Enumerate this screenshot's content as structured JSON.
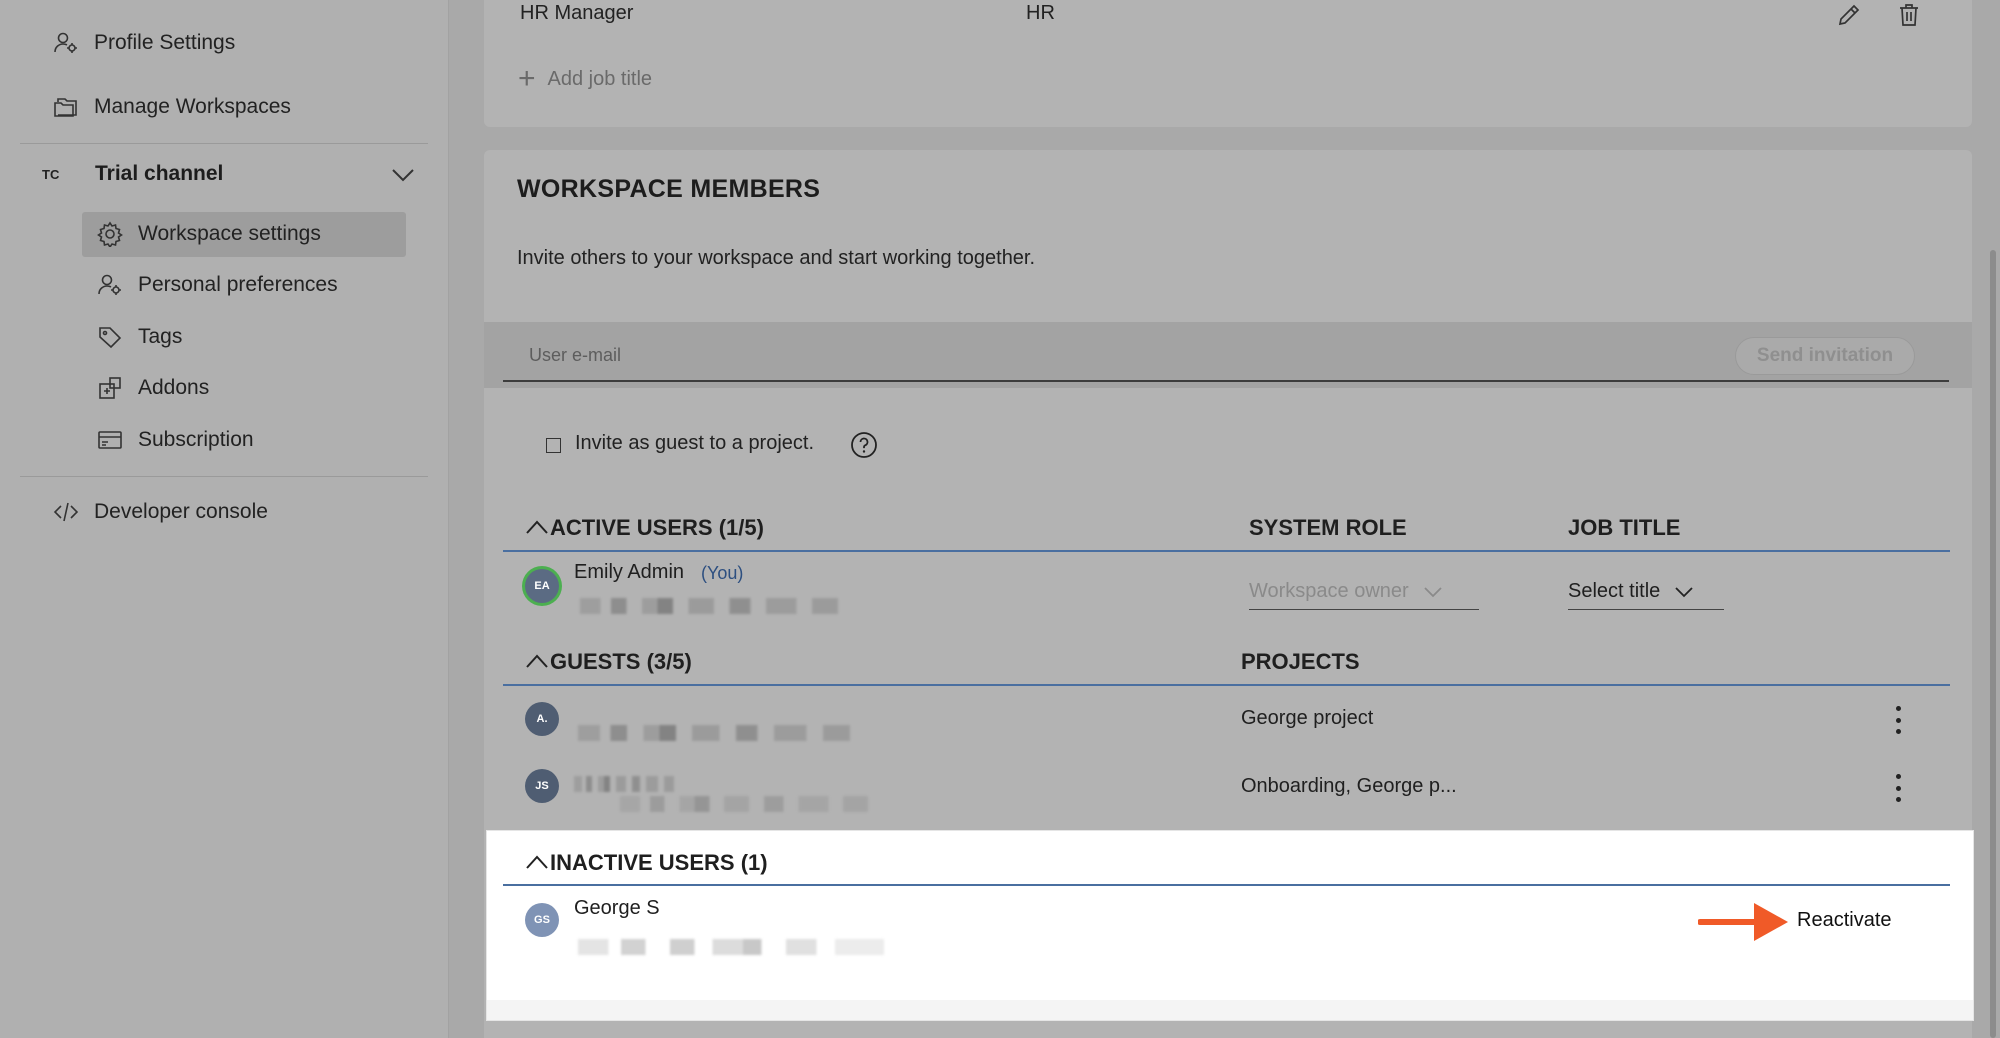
{
  "sidebar": {
    "top_items": [
      {
        "label": "Profile Settings",
        "icon": "user-gear-icon"
      },
      {
        "label": "Manage Workspaces",
        "icon": "folder-icon"
      }
    ],
    "channel": {
      "badge": "TC",
      "name": "Trial channel"
    },
    "channel_items": [
      {
        "label": "Workspace settings",
        "icon": "gear-icon",
        "active": true
      },
      {
        "label": "Personal preferences",
        "icon": "user-gear-icon"
      },
      {
        "label": "Tags",
        "icon": "tag-icon"
      },
      {
        "label": "Addons",
        "icon": "addons-icon"
      },
      {
        "label": "Subscription",
        "icon": "card-icon"
      }
    ],
    "developer": {
      "label": "Developer console",
      "icon": "code-icon"
    }
  },
  "job_titles": {
    "row": {
      "title": "HR Manager",
      "department": "HR"
    },
    "add_label": "Add job title"
  },
  "members": {
    "title": "WORKSPACE MEMBERS",
    "subtitle": "Invite others to your workspace and start working together.",
    "email_placeholder": "User e-mail",
    "send_label": "Send invitation",
    "guest_checkbox_label": "Invite as guest to a project.",
    "active": {
      "header": "ACTIVE USERS (1/5)",
      "role_header": "SYSTEM ROLE",
      "job_header": "JOB TITLE",
      "users": [
        {
          "initials": "EA",
          "name": "Emily Admin",
          "you_tag": "(You)",
          "role": "Workspace owner",
          "job": "Select title"
        }
      ]
    },
    "guests": {
      "header": "GUESTS (3/5)",
      "projects_header": "PROJECTS",
      "users": [
        {
          "initials": "A.",
          "projects": "George project"
        },
        {
          "initials": "JS",
          "projects": "Onboarding, George p..."
        }
      ]
    },
    "inactive": {
      "header": "INACTIVE USERS (1)",
      "users": [
        {
          "initials": "GS",
          "name": "George S",
          "action": "Reactivate"
        }
      ]
    }
  },
  "colors": {
    "accent_rule": "#4a6fa0",
    "arrow": "#f05a28",
    "avatar_ea": "#5b6b83",
    "avatar_guest": "#4f5d72",
    "avatar_gs": "#7f93b5"
  }
}
